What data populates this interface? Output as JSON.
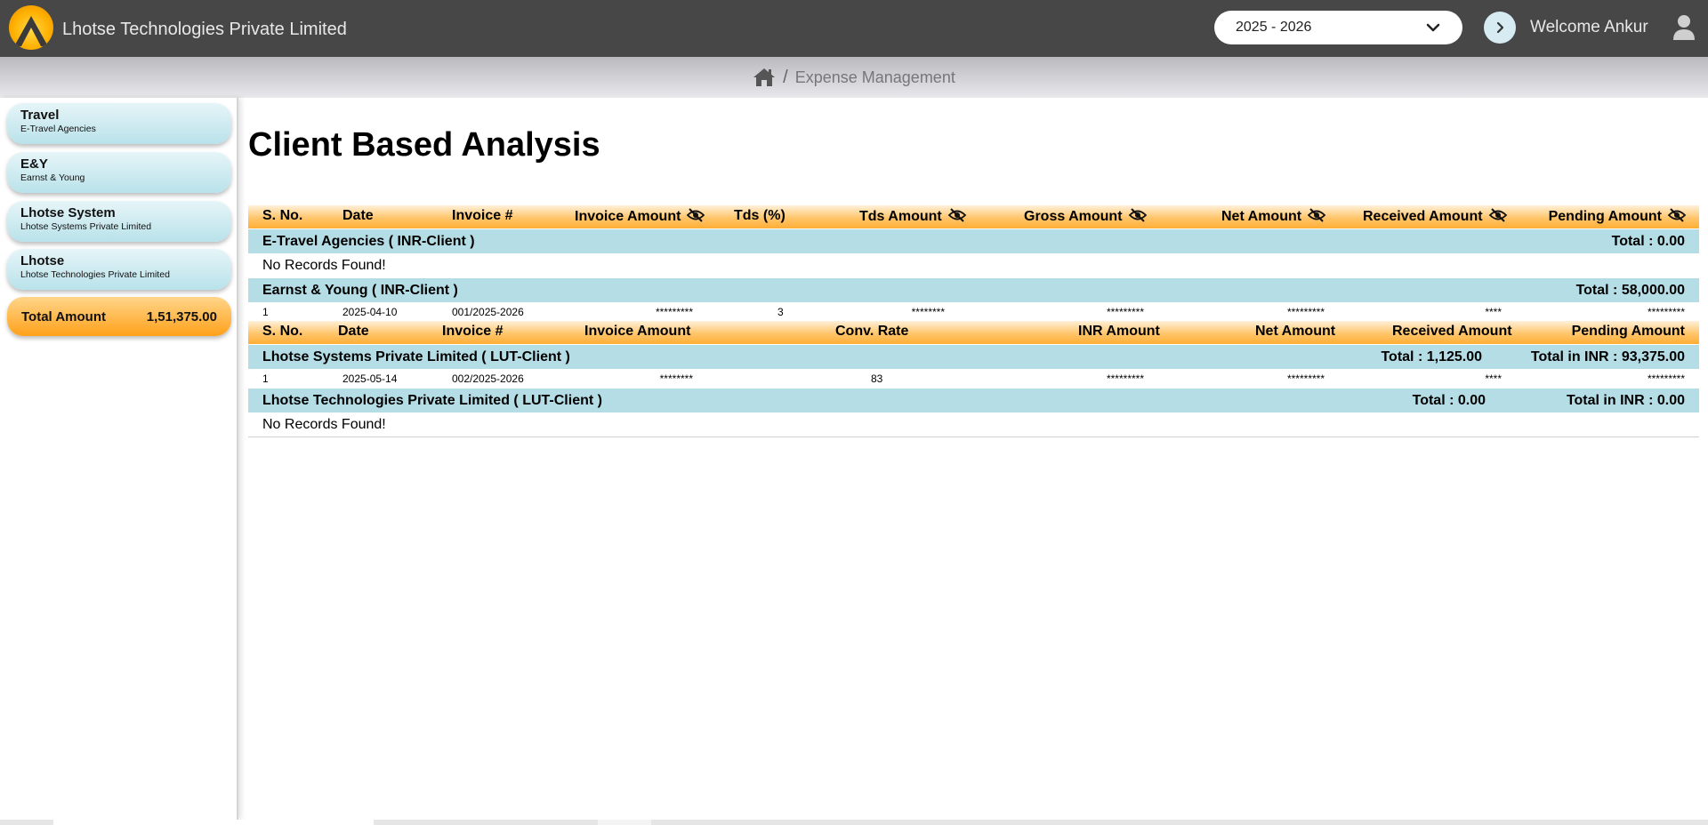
{
  "header": {
    "company_name": "Lhotse Technologies Private Limited",
    "fiscal_year": "2025 - 2026",
    "welcome_text": "Welcome Ankur"
  },
  "breadcrumb": {
    "current": "Expense Management"
  },
  "sidebar": {
    "items": [
      {
        "title": "Travel",
        "subtitle": "E-Travel Agencies"
      },
      {
        "title": "E&Y",
        "subtitle": "Earnst & Young"
      },
      {
        "title": "Lhotse System",
        "subtitle": "Lhotse Systems Private Limited"
      },
      {
        "title": "Lhotse",
        "subtitle": "Lhotse Technologies Private Limited"
      }
    ],
    "total_label": "Total Amount",
    "total_value": "1,51,375.00"
  },
  "page_title": "Client Based Analysis",
  "inr_table": {
    "headers": {
      "sno": "S. No.",
      "date": "Date",
      "invoice": "Invoice #",
      "invoice_amount": "Invoice Amount",
      "tds_pct": "Tds (%)",
      "tds_amount": "Tds Amount",
      "gross_amount": "Gross Amount",
      "net_amount": "Net Amount",
      "received_amount": "Received Amount",
      "pending_amount": "Pending Amount"
    },
    "groups": [
      {
        "name": "E-Travel Agencies ( INR-Client )",
        "total": "Total : 0.00",
        "message": "No Records Found!"
      },
      {
        "name": "Earnst & Young ( INR-Client )",
        "total": "Total : 58,000.00",
        "rows": [
          {
            "sno": "1",
            "date": "2025-04-10",
            "invoice": "001/2025-2026",
            "invoice_amount": "*********",
            "tds_pct": "3",
            "tds_amount": "********",
            "gross_amount": "*********",
            "net_amount": "*********",
            "received_amount": "****",
            "pending_amount": "*********"
          }
        ]
      }
    ]
  },
  "lut_table": {
    "headers": {
      "sno": "S. No.",
      "date": "Date",
      "invoice": "Invoice #",
      "invoice_amount": "Invoice Amount",
      "conv_rate": "Conv. Rate",
      "inr_amount": "INR Amount",
      "net_amount": "Net Amount",
      "received_amount": "Received Amount",
      "pending_amount": "Pending Amount"
    },
    "groups": [
      {
        "name": "Lhotse Systems Private Limited ( LUT-Client )",
        "total": "Total : 1,125.00",
        "total_inr": "Total in INR : 93,375.00",
        "rows": [
          {
            "sno": "1",
            "date": "2025-05-14",
            "invoice": "002/2025-2026",
            "invoice_amount": "********",
            "conv_rate": "83",
            "inr_amount": "*********",
            "net_amount": "*********",
            "received_amount": "****",
            "pending_amount": "*********"
          }
        ]
      },
      {
        "name": "Lhotse Technologies Private Limited ( LUT-Client )",
        "total": "Total : 0.00",
        "total_inr": "Total in INR : 0.00",
        "message": "No Records Found!"
      }
    ]
  },
  "colors": {
    "topbar": "#474747",
    "header_orange": "#ffae36",
    "group_blue": "#b5dde6",
    "sidebar_card": "#b9e2ea"
  },
  "icons": [
    "logo-icon",
    "chevron-down-icon",
    "chevron-right-icon",
    "user-icon",
    "home-icon",
    "eye-slash-icon"
  ]
}
